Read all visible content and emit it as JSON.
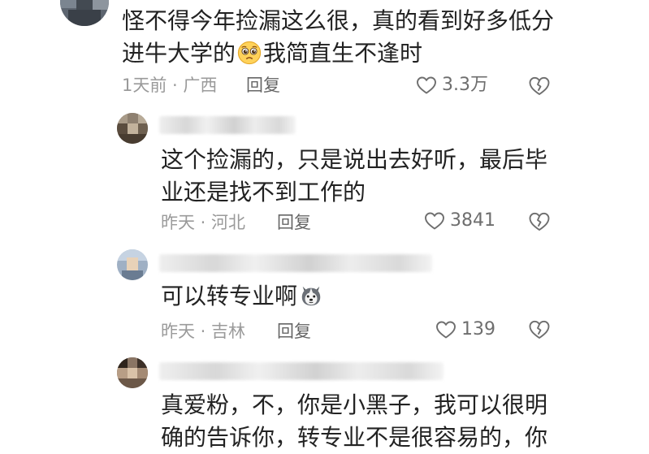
{
  "comments": [
    {
      "text_lines": [
        "怪不得今年捡漏这么很，真的看到好多低分",
        "进牛大学的",
        "我简直生不逢时"
      ],
      "emoji": "pleading-face",
      "time_location": "1天前 · 广西",
      "reply_label": "回复",
      "likes": "3.3万"
    },
    {
      "text_lines": [
        "这个捡漏的，只是说出去好听，最后毕",
        "业还是找不到工作的"
      ],
      "time_location": "昨天 · 河北",
      "reply_label": "回复",
      "likes": "3841"
    },
    {
      "text_lines": [
        "可以转专业啊"
      ],
      "emoji": "husky-dog-face",
      "time_location": "昨天 · 吉林",
      "reply_label": "回复",
      "likes": "139"
    },
    {
      "text_lines": [
        "真爱粉，不，你是小黑子，我可以很明",
        "确的告诉你，转专业不是很容易的，你"
      ]
    }
  ],
  "colors": {
    "text": "#222222",
    "meta": "#9a9a9a",
    "icon": "#6e6e6e",
    "background": "#ffffff"
  }
}
